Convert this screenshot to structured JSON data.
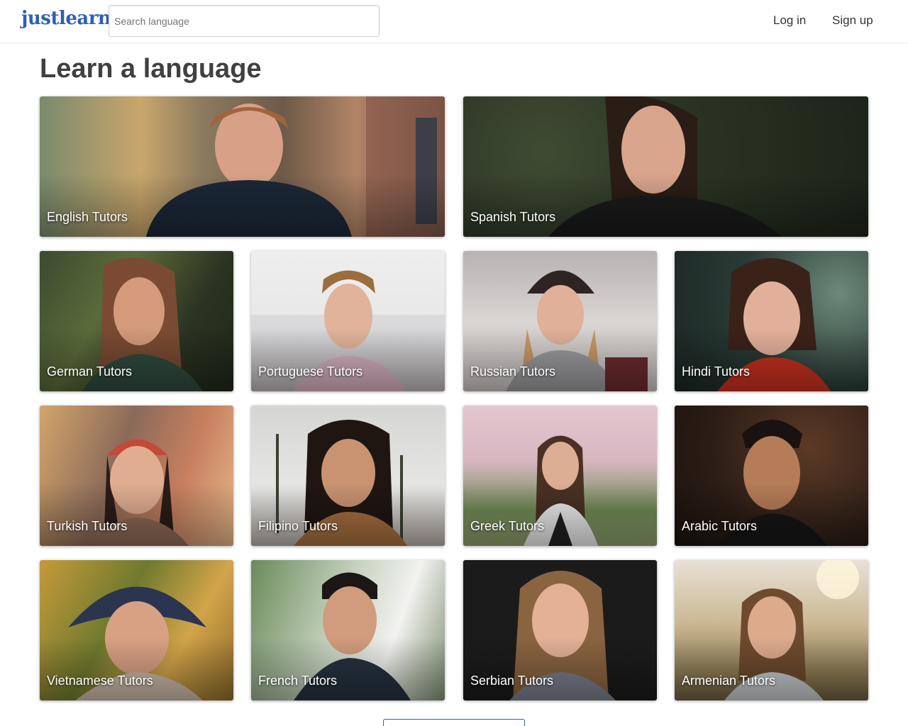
{
  "header": {
    "logo": "justlearn",
    "search_placeholder": "Search language",
    "login_label": "Log in",
    "signup_label": "Sign up"
  },
  "page": {
    "title": "Learn a language"
  },
  "cards": [
    {
      "label": "English Tutors"
    },
    {
      "label": "Spanish Tutors"
    },
    {
      "label": "German Tutors"
    },
    {
      "label": "Portuguese Tutors"
    },
    {
      "label": "Russian Tutors"
    },
    {
      "label": "Hindi Tutors"
    },
    {
      "label": "Turkish Tutors"
    },
    {
      "label": "Filipino Tutors"
    },
    {
      "label": "Greek Tutors"
    },
    {
      "label": "Arabic Tutors"
    },
    {
      "label": "Vietnamese Tutors"
    },
    {
      "label": "French Tutors"
    },
    {
      "label": "Serbian Tutors"
    },
    {
      "label": "Armenian Tutors"
    }
  ],
  "colors": {
    "brand": "#2f5fb3",
    "title": "#404040",
    "text": "#333333"
  }
}
